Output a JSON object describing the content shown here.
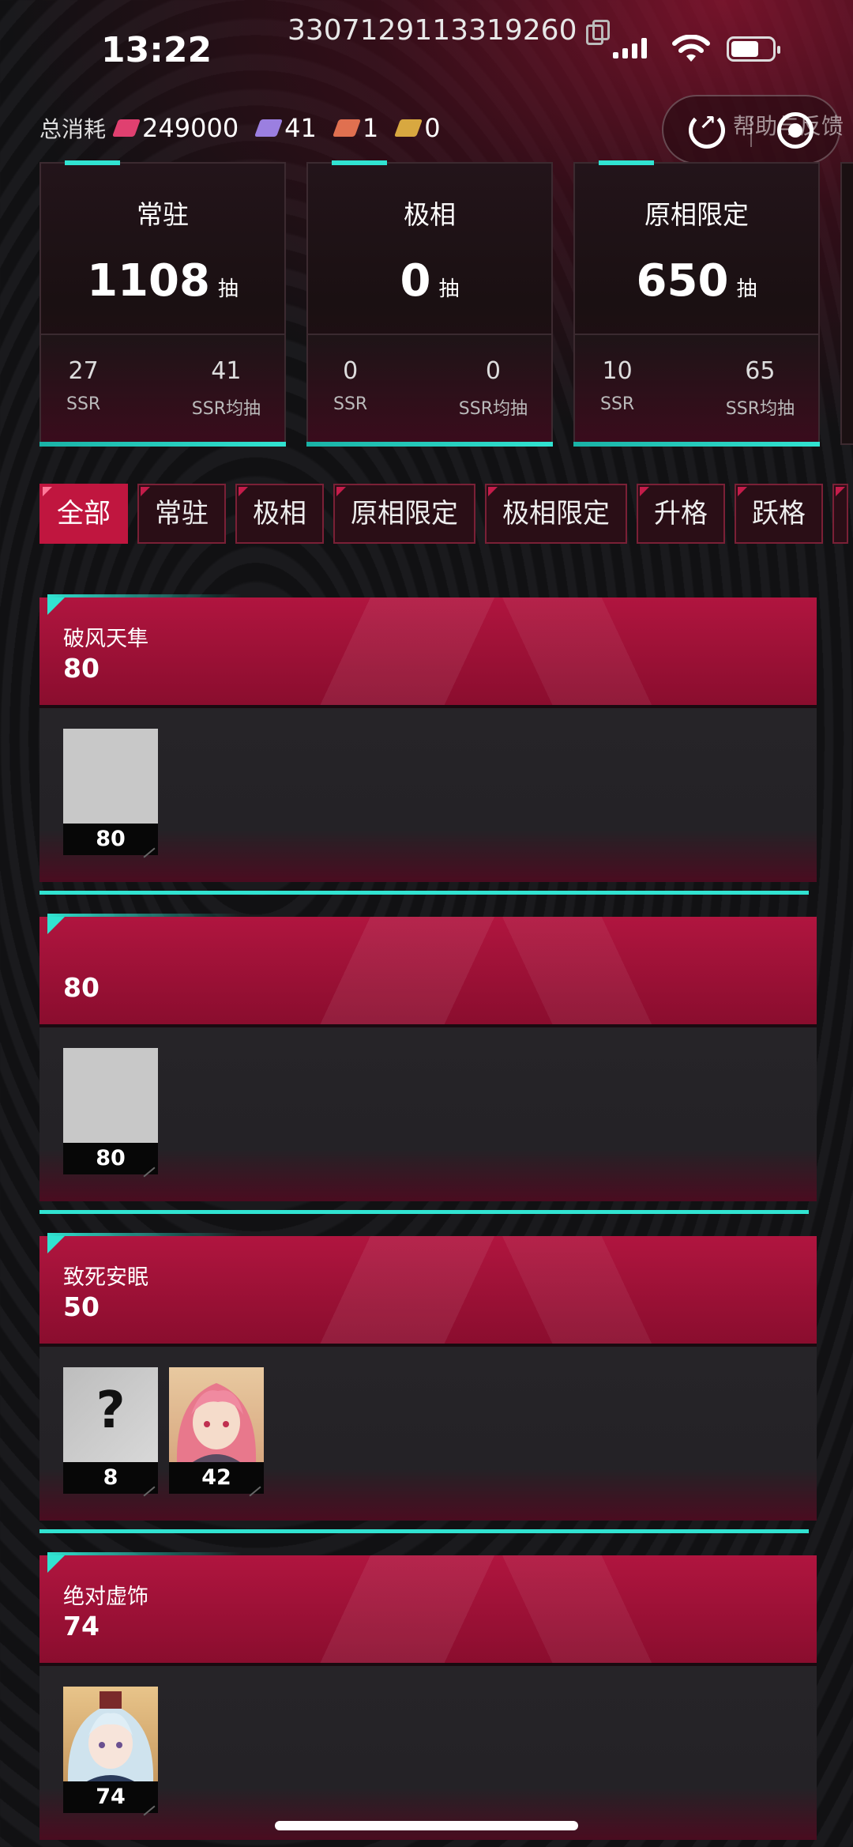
{
  "status_bar": {
    "time": "13:22",
    "uid": "3307129113319260"
  },
  "consumption": {
    "label": "总消耗",
    "currencies": [
      {
        "icon": "crystal-icon",
        "value": "249000",
        "color": "#e04070"
      },
      {
        "icon": "ticket-icon",
        "value": "41",
        "color": "#9b7fe0"
      },
      {
        "icon": "limited-ticket-icon",
        "value": "1",
        "color": "#e07050"
      },
      {
        "icon": "gold-ticket-icon",
        "value": "0",
        "color": "#d8a840"
      }
    ]
  },
  "help": {
    "label": "帮助与反馈"
  },
  "stats": [
    {
      "title": "常驻",
      "count": "1108",
      "unit": "抽",
      "ssr": "27",
      "ssr_label": "SSR",
      "avg": "41",
      "avg_label": "SSR均抽"
    },
    {
      "title": "极相",
      "count": "0",
      "unit": "抽",
      "ssr": "0",
      "ssr_label": "SSR",
      "avg": "0",
      "avg_label": "SSR均抽"
    },
    {
      "title": "原相限定",
      "count": "650",
      "unit": "抽",
      "ssr": "10",
      "ssr_label": "SSR",
      "avg": "65",
      "avg_label": "SSR均抽"
    }
  ],
  "tabs": [
    "全部",
    "常驻",
    "极相",
    "原相限定",
    "极相限定",
    "升格",
    "跃格"
  ],
  "active_tab": 0,
  "pools": [
    {
      "name": "破风天隼",
      "count": "80",
      "items": [
        {
          "kind": "blank",
          "count": "80"
        }
      ]
    },
    {
      "name": "",
      "count": "80",
      "items": [
        {
          "kind": "blank",
          "count": "80"
        }
      ]
    },
    {
      "name": "致死安眠",
      "count": "50",
      "items": [
        {
          "kind": "unknown",
          "count": "8"
        },
        {
          "kind": "pink-hair-character",
          "count": "42"
        }
      ]
    },
    {
      "name": "绝对虚饰",
      "count": "74",
      "items": [
        {
          "kind": "silver-hair-character",
          "count": "74"
        }
      ]
    }
  ],
  "colors": {
    "accent_cyan": "#31e3d1",
    "accent_red": "#c0163f"
  }
}
